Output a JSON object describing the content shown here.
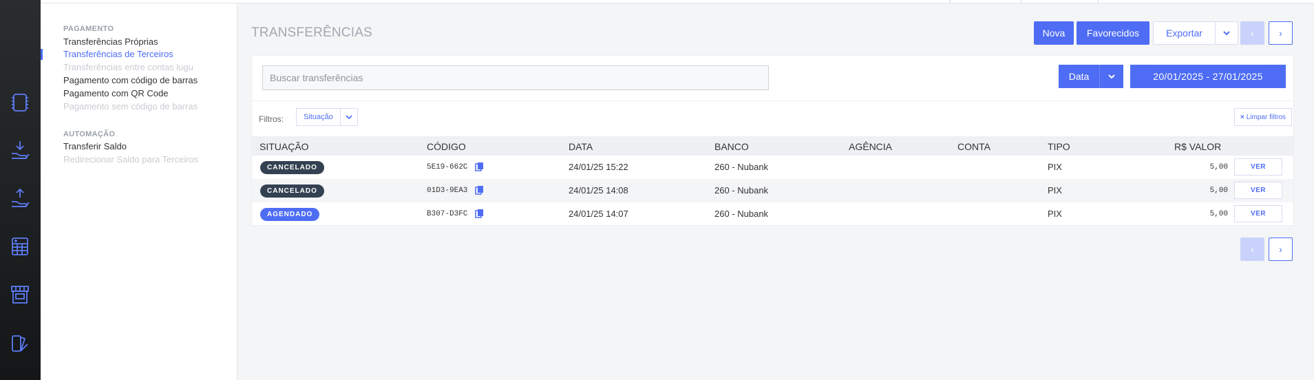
{
  "submenu": {
    "sections": [
      {
        "title": "PAGAMENTO",
        "items": [
          {
            "label": "Transferências Próprias",
            "state": "normal"
          },
          {
            "label": "Transferências de Terceiros",
            "state": "active"
          },
          {
            "label": "Transferências entre contas lugu",
            "state": "disabled"
          },
          {
            "label": "Pagamento com código de barras",
            "state": "normal"
          },
          {
            "label": "Pagamento com QR Code",
            "state": "normal"
          },
          {
            "label": "Pagamento sem código de barras",
            "state": "disabled"
          }
        ]
      },
      {
        "title": "AUTOMAÇÃO",
        "items": [
          {
            "label": "Transferir Saldo",
            "state": "normal"
          },
          {
            "label": "Redirecionar Saldo para Terceiros",
            "state": "disabled"
          }
        ]
      }
    ]
  },
  "rail_icons": [
    "ledger-icon",
    "receive-money-icon",
    "send-money-icon",
    "calculator-icon",
    "store-icon",
    "reports-icon"
  ],
  "page": {
    "title": "TRANSFERÊNCIAS"
  },
  "toolbar": {
    "nova": "Nova",
    "favoritos": "Favorecidos",
    "exportar": "Exportar",
    "prev": "‹",
    "next": "›"
  },
  "search": {
    "placeholder": "Buscar transferências"
  },
  "date_filter": {
    "field": "Data",
    "range": "20/01/2025 - 27/01/2025"
  },
  "filters": {
    "label": "Filtros:",
    "situacao": "Situação",
    "clear": "Limpar filtros"
  },
  "table": {
    "headers": {
      "situacao": "SITUAÇÃO",
      "codigo": "CÓDIGO",
      "data": "DATA",
      "banco": "BANCO",
      "agencia": "AGÊNCIA",
      "conta": "CONTA",
      "tipo": "TIPO",
      "valor": "R$ VALOR"
    },
    "rows": [
      {
        "situacao": "CANCELADO",
        "codigo": "5E19-662C",
        "data": "24/01/25 15:22",
        "banco": "260 - Nubank",
        "agencia": "",
        "conta": "",
        "tipo": "PIX",
        "valor": "5,00",
        "action": "VER"
      },
      {
        "situacao": "CANCELADO",
        "codigo": "01D3-9EA3",
        "data": "24/01/25 14:08",
        "banco": "260 - Nubank",
        "agencia": "",
        "conta": "",
        "tipo": "PIX",
        "valor": "5,00",
        "action": "VER"
      },
      {
        "situacao": "AGENDADO",
        "codigo": "B307-D3FC",
        "data": "24/01/25 14:07",
        "banco": "260 - Nubank",
        "agencia": "",
        "conta": "",
        "tipo": "PIX",
        "valor": "5,00",
        "action": "VER"
      }
    ]
  },
  "pager": {
    "prev": "‹",
    "next": "›"
  },
  "colors": {
    "accent": "#4e6cf4",
    "cancelled": "#344152",
    "scheduled": "#4e6cf4"
  }
}
